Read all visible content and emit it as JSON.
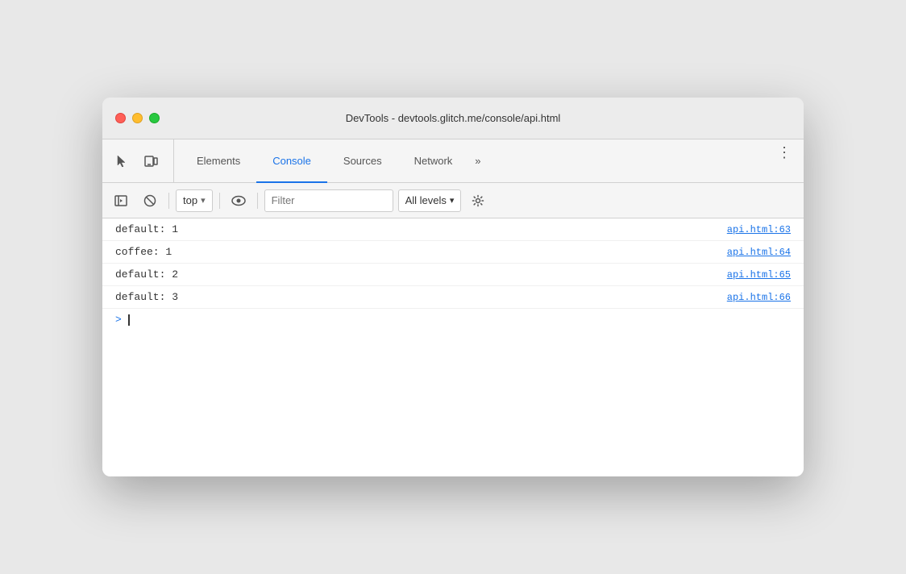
{
  "window": {
    "title": "DevTools - devtools.glitch.me/console/api.html"
  },
  "tabs": [
    {
      "id": "elements",
      "label": "Elements",
      "active": false
    },
    {
      "id": "console",
      "label": "Console",
      "active": true
    },
    {
      "id": "sources",
      "label": "Sources",
      "active": false
    },
    {
      "id": "network",
      "label": "Network",
      "active": false
    }
  ],
  "more_tabs_label": "»",
  "menu_icon": "⋮",
  "toolbar_icons": {
    "cursor": "⬚",
    "device": "⬚"
  },
  "console_toolbar": {
    "clear_label": "🚫",
    "context_value": "top",
    "context_arrow": "▾",
    "filter_placeholder": "Filter",
    "levels_label": "All levels",
    "levels_arrow": "▾"
  },
  "console_entries": [
    {
      "text": "default: 1",
      "link": "api.html:63"
    },
    {
      "text": "coffee: 1",
      "link": "api.html:64"
    },
    {
      "text": "default: 2",
      "link": "api.html:65"
    },
    {
      "text": "default: 3",
      "link": "api.html:66"
    }
  ],
  "console_prompt": ">"
}
